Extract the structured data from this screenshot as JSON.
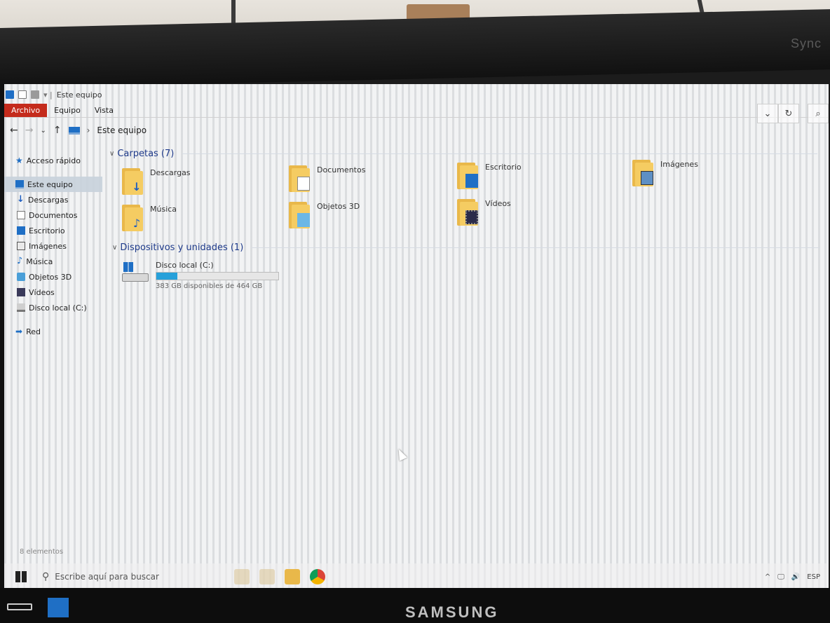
{
  "bezel": {
    "brand_bottom": "SAMSUNG",
    "brand_top": "Sync"
  },
  "window": {
    "title": "Este equipo",
    "ribbon_tabs": [
      {
        "label": "Archivo",
        "active": true
      },
      {
        "label": "Equipo",
        "active": false
      },
      {
        "label": "Vista",
        "active": false
      }
    ],
    "ribbon_right": {
      "expand_glyph": "⌄",
      "refresh_glyph": "↻",
      "search_glyph": "⌕"
    }
  },
  "address": {
    "back_glyph": "←",
    "forward_glyph": "→",
    "recent_glyph": "⌄",
    "up_glyph": "↑",
    "sep": "›",
    "crumb": "Este equipo"
  },
  "sidebar": {
    "items": [
      {
        "label": "Acceso rápido",
        "icon": "star-icon",
        "glyph": "★"
      },
      {
        "label": "Este equipo",
        "icon": "this-pc-icon",
        "selected": true
      },
      {
        "label": "Descargas",
        "icon": "download-icon",
        "glyph": "↓"
      },
      {
        "label": "Documentos",
        "icon": "document-icon"
      },
      {
        "label": "Escritorio",
        "icon": "desktop-icon"
      },
      {
        "label": "Imágenes",
        "icon": "pictures-icon"
      },
      {
        "label": "Música",
        "icon": "music-icon",
        "glyph": "♪"
      },
      {
        "label": "Objetos 3D",
        "icon": "objects-3d-icon"
      },
      {
        "label": "Vídeos",
        "icon": "videos-icon"
      },
      {
        "label": "Disco local (C:)",
        "icon": "local-disk-icon"
      },
      {
        "label": "Red",
        "icon": "network-icon",
        "glyph": "➡"
      }
    ]
  },
  "content": {
    "folders_group": {
      "chevron": "∨",
      "title": "Carpetas (7)",
      "folders": [
        {
          "label": "Descargas",
          "icon": "downloads-folder-icon",
          "overlay": "↓"
        },
        {
          "label": "Documentos",
          "icon": "documents-folder-icon"
        },
        {
          "label": "Escritorio",
          "icon": "desktop-folder-icon"
        },
        {
          "label": "Imágenes",
          "icon": "pictures-folder-icon"
        },
        {
          "label": "Música",
          "icon": "music-folder-icon",
          "overlay": "♪"
        },
        {
          "label": "Objetos 3D",
          "icon": "objects-3d-folder-icon"
        },
        {
          "label": "Vídeos",
          "icon": "videos-folder-icon"
        }
      ]
    },
    "devices_group": {
      "chevron": "∨",
      "title": "Dispositivos y unidades (1)",
      "drive": {
        "name": "Disco local (C:)",
        "free_text": "383 GB disponibles de 464 GB",
        "used_fraction": 0.175
      }
    }
  },
  "status": {
    "items_text": "8 elementos"
  },
  "taskbar": {
    "search_glyph": "⚲",
    "search_placeholder": "Escribe aquí para buscar",
    "tray_chevron": "^",
    "tray_monitor": "🖵",
    "tray_volume": "🔊",
    "tray_lang": "ESP"
  },
  "colors": {
    "accent": "#1f6fc5",
    "archivo_tab": "#c42b1c",
    "folder": "#f5cc62",
    "progress": "#26a0da"
  }
}
